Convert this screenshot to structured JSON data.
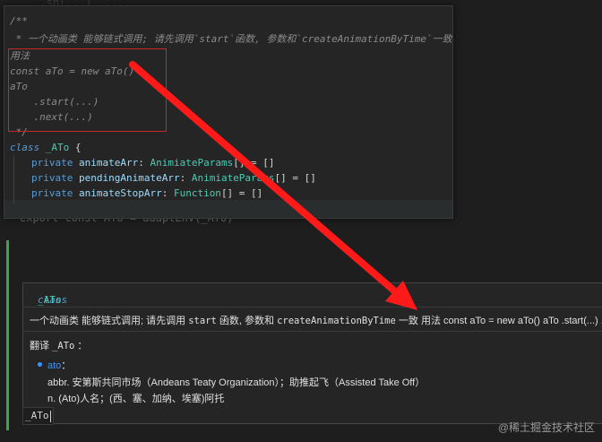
{
  "editor_bg": {
    "top_line": "...sh(...)  ....",
    "export_line": "export const ATo = adaptEnv(_ATo)"
  },
  "code_popup": {
    "lines": {
      "c0": "/**",
      "c1": " * 一个动画类 能够链式调用; 请先调用`start`函数, 参数和`createAnimationByTime`一致",
      "c2": "用法",
      "c3": "const aTo = new aTo()",
      "c4": "aTo",
      "c5": "    .start(...)",
      "c6": "    .next(...)",
      "c7": " */",
      "class_kw": "class",
      "class_name": "_ATo",
      "brace": " {",
      "f1_kw": "private",
      "f1_name": "animateArr",
      "f1_type": "AnimiateParams",
      "f1_rest": "[] = []",
      "f2_kw": "private",
      "f2_name": "pendingAnimateArr",
      "f2_type": "AnimiateParams",
      "f2_rest": "[] = []",
      "f3_kw": "private",
      "f3_name": "animateStopArr",
      "f3_type": "Function",
      "f3_rest": "[] = []"
    }
  },
  "hover_popup": {
    "header_kw": "class",
    "header_name": "_ATo",
    "desc_prefix": "一个动画类 能够链式调用; 请先调用 ",
    "desc_code1": "start",
    "desc_mid1": " 函数, 参数和 ",
    "desc_code2": "createAnimationByTime",
    "desc_suffix": " 一致 用法 const aTo = new aTo() aTo .start(...) .next(...)",
    "translate_label": "翻译",
    "translate_code": "_ATo",
    "translate_colon": "：",
    "entry_word": "ato",
    "entry_colon": "：",
    "def1": "abbr. 安第斯共同市场（Andeans Teaty Organization）；助推起飞（Assisted Take Off）",
    "def2": "n. (Ato)人名；(西、塞、加纳、埃塞)阿托"
  },
  "typed_text": "_ATo",
  "watermark": "@稀土掘金技术社区",
  "colors": {
    "arrow": "#ff1a1a",
    "red_box": "#c62828",
    "link": "#3794ff",
    "green_gutter": "#3fa34d"
  }
}
